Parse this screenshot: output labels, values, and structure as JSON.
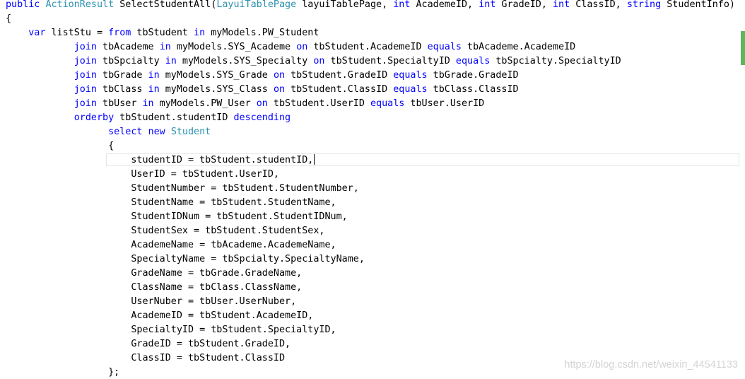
{
  "editor": {
    "code_lines": [
      [
        [
          "kw",
          "public"
        ],
        [
          "p",
          " "
        ],
        [
          "ty",
          "ActionResult"
        ],
        [
          "p",
          " SelectStudentAll("
        ],
        [
          "ty",
          "LayuiTablePage"
        ],
        [
          "p",
          " layuiTablePage, "
        ],
        [
          "kw",
          "int"
        ],
        [
          "p",
          " AcademeID, "
        ],
        [
          "kw",
          "int"
        ],
        [
          "p",
          " GradeID, "
        ],
        [
          "kw",
          "int"
        ],
        [
          "p",
          " ClassID, "
        ],
        [
          "kw",
          "string"
        ],
        [
          "p",
          " StudentInfo)"
        ]
      ],
      [
        [
          "p",
          "{"
        ]
      ],
      [
        [
          "p",
          "    "
        ],
        [
          "kw",
          "var"
        ],
        [
          "p",
          " listStu = "
        ],
        [
          "kw",
          "from"
        ],
        [
          "p",
          " tbStudent "
        ],
        [
          "kw",
          "in"
        ],
        [
          "p",
          " myModels.PW_Student"
        ]
      ],
      [
        [
          "p",
          "            "
        ],
        [
          "kw",
          "join"
        ],
        [
          "p",
          " tbAcademe "
        ],
        [
          "kw",
          "in"
        ],
        [
          "p",
          " myModels.SYS_Academe "
        ],
        [
          "kw",
          "on"
        ],
        [
          "p",
          " tbStudent.AcademeID "
        ],
        [
          "kw",
          "equals"
        ],
        [
          "p",
          " tbAcademe.AcademeID"
        ]
      ],
      [
        [
          "p",
          "            "
        ],
        [
          "kw",
          "join"
        ],
        [
          "p",
          " tbSpcialty "
        ],
        [
          "kw",
          "in"
        ],
        [
          "p",
          " myModels.SYS_Specialty "
        ],
        [
          "kw",
          "on"
        ],
        [
          "p",
          " tbStudent.SpecialtyID "
        ],
        [
          "kw",
          "equals"
        ],
        [
          "p",
          " tbSpcialty.SpecialtyID"
        ]
      ],
      [
        [
          "p",
          "            "
        ],
        [
          "kw",
          "join"
        ],
        [
          "p",
          " tbGrade "
        ],
        [
          "kw",
          "in"
        ],
        [
          "p",
          " myModels.SYS_Grade "
        ],
        [
          "kw",
          "on"
        ],
        [
          "p",
          " tbStudent.GradeID "
        ],
        [
          "kw",
          "equals"
        ],
        [
          "p",
          " tbGrade.GradeID"
        ]
      ],
      [
        [
          "p",
          "            "
        ],
        [
          "kw",
          "join"
        ],
        [
          "p",
          " tbClass "
        ],
        [
          "kw",
          "in"
        ],
        [
          "p",
          " myModels.SYS_Class "
        ],
        [
          "kw",
          "on"
        ],
        [
          "p",
          " tbStudent.ClassID "
        ],
        [
          "kw",
          "equals"
        ],
        [
          "p",
          " tbClass.ClassID"
        ]
      ],
      [
        [
          "p",
          "            "
        ],
        [
          "kw",
          "join"
        ],
        [
          "p",
          " tbUser "
        ],
        [
          "kw",
          "in"
        ],
        [
          "p",
          " myModels.PW_User "
        ],
        [
          "kw",
          "on"
        ],
        [
          "p",
          " tbStudent.UserID "
        ],
        [
          "kw",
          "equals"
        ],
        [
          "p",
          " tbUser.UserID"
        ]
      ],
      [
        [
          "p",
          "            "
        ],
        [
          "kw",
          "orderby"
        ],
        [
          "p",
          " tbStudent.studentID "
        ],
        [
          "kw",
          "descending"
        ]
      ],
      [
        [
          "p",
          "                  "
        ],
        [
          "kw",
          "select"
        ],
        [
          "p",
          " "
        ],
        [
          "kw",
          "new"
        ],
        [
          "p",
          " "
        ],
        [
          "ty",
          "Student"
        ]
      ],
      [
        [
          "p",
          "                  {"
        ]
      ],
      [
        [
          "p",
          "                      studentID = tbStudent.studentID,"
        ]
      ],
      [
        [
          "p",
          "                      UserID = tbStudent.UserID,"
        ]
      ],
      [
        [
          "p",
          "                      StudentNumber = tbStudent.StudentNumber,"
        ]
      ],
      [
        [
          "p",
          "                      StudentName = tbStudent.StudentName,"
        ]
      ],
      [
        [
          "p",
          "                      StudentIDNum = tbStudent.StudentIDNum,"
        ]
      ],
      [
        [
          "p",
          "                      StudentSex = tbStudent.StudentSex,"
        ]
      ],
      [
        [
          "p",
          "                      AcademeName = tbAcademe.AcademeName,"
        ]
      ],
      [
        [
          "p",
          "                      SpecialtyName = tbSpcialty.SpecialtyName,"
        ]
      ],
      [
        [
          "p",
          "                      GradeName = tbGrade.GradeName,"
        ]
      ],
      [
        [
          "p",
          "                      ClassName = tbClass.ClassName,"
        ]
      ],
      [
        [
          "p",
          "                      UserNuber = tbUser.UserNuber,"
        ]
      ],
      [
        [
          "p",
          "                      AcademeID = tbStudent.AcademeID,"
        ]
      ],
      [
        [
          "p",
          "                      SpecialtyID = tbStudent.SpecialtyID,"
        ]
      ],
      [
        [
          "p",
          "                      GradeID = tbStudent.GradeID,"
        ]
      ],
      [
        [
          "p",
          "                      ClassID = tbStudent.ClassID"
        ]
      ],
      [
        [
          "p",
          "                  };"
        ]
      ]
    ],
    "caret_line": 11
  },
  "watermark": "https://blog.csdn.net/weixin_44541133",
  "colors": {
    "keyword": "#0000ff",
    "type": "#2b91af",
    "plain": "#000000",
    "change_bar": "#5cb85c"
  }
}
